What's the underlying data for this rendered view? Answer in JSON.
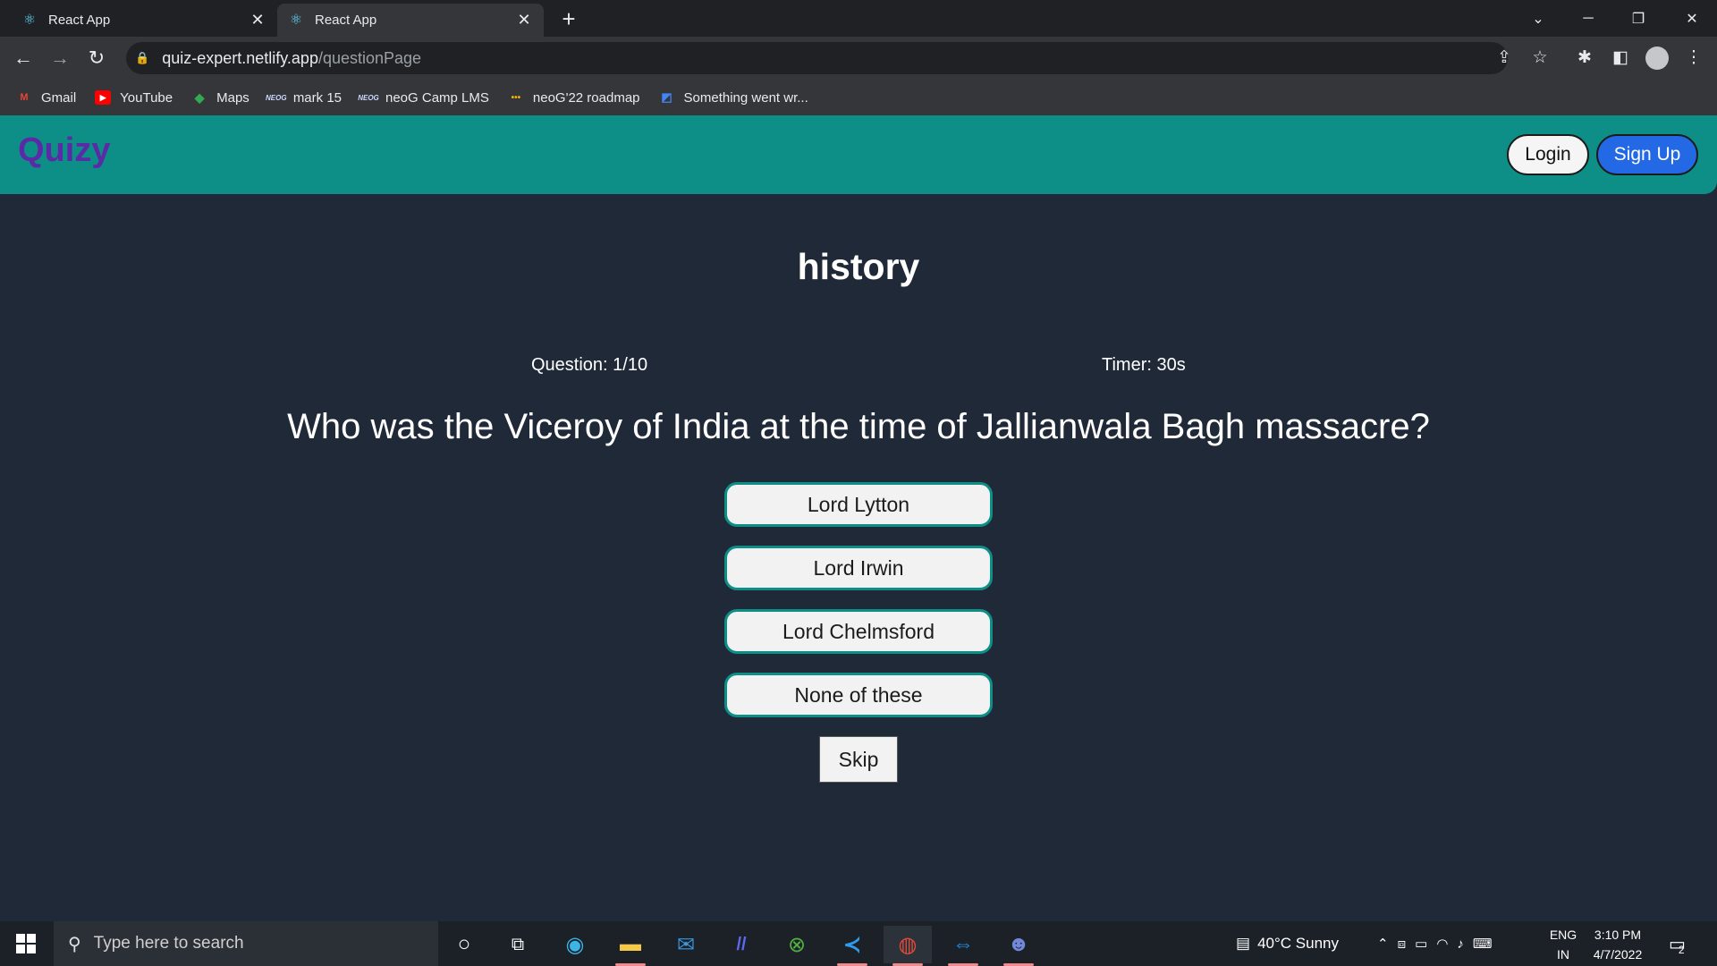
{
  "browser": {
    "tabs": [
      {
        "title": "React App",
        "active": false
      },
      {
        "title": "React App",
        "active": true
      }
    ],
    "url_host": "quiz-expert.netlify.app",
    "url_path": "/questionPage",
    "bookmarks": [
      {
        "label": "Gmail",
        "icon": "gmail-icon"
      },
      {
        "label": "YouTube",
        "icon": "youtube-icon"
      },
      {
        "label": "Maps",
        "icon": "maps-icon"
      },
      {
        "label": "mark 15",
        "icon": "neog-icon"
      },
      {
        "label": "neoG Camp LMS",
        "icon": "neog-icon"
      },
      {
        "label": "neoG'22 roadmap",
        "icon": "roadmap-icon"
      },
      {
        "label": "Something went wr...",
        "icon": "page-icon"
      }
    ]
  },
  "app": {
    "logo": "Quizy",
    "login_label": "Login",
    "signup_label": "Sign Up",
    "quiz_title": "history",
    "question_counter": "Question: 1/10",
    "timer": "Timer: 30s",
    "question": "Who was the Viceroy of India at the time of Jallianwala Bagh massacre?",
    "options": [
      "Lord Lytton",
      "Lord Irwin",
      "Lord Chelmsford",
      "None of these"
    ],
    "skip_label": "Skip",
    "colors": {
      "header": "#0d8f87",
      "logo": "#5b2aa6",
      "signup": "#2369e6",
      "background": "#202938"
    }
  },
  "taskbar": {
    "search_placeholder": "Type here to search",
    "weather": "40°C  Sunny",
    "lang_top": "ENG",
    "lang_bottom": "IN",
    "time": "3:10 PM",
    "date": "4/7/2022",
    "notification_count": "2"
  }
}
